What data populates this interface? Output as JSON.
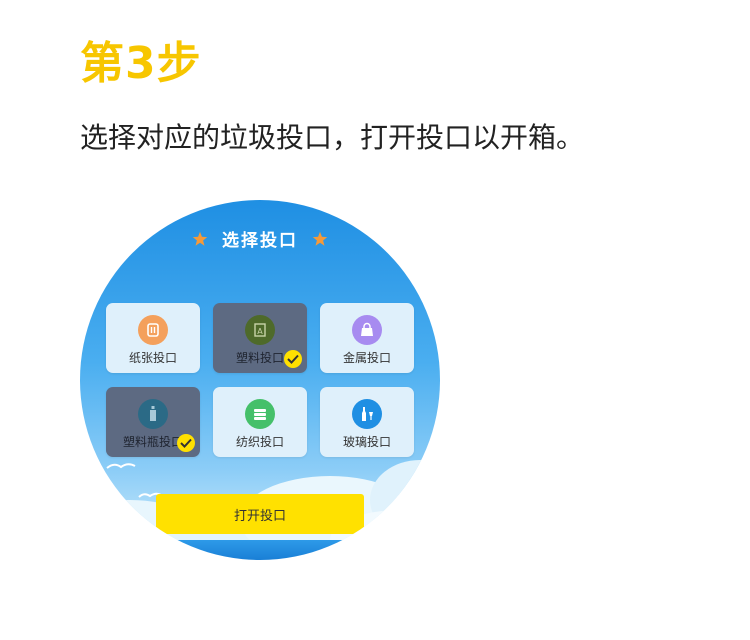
{
  "step": {
    "title": "第3步"
  },
  "instruction": {
    "text": "选择对应的垃圾投口，打开投口以开箱。"
  },
  "screen": {
    "header_title": "选择投口",
    "tiles": [
      {
        "label": "纸张投口",
        "icon": "paper-icon",
        "color": "#f4a05c",
        "selected": false
      },
      {
        "label": "塑料投口",
        "icon": "plastic-icon",
        "color": "#4e6a2a",
        "selected": true
      },
      {
        "label": "金属投口",
        "icon": "metal-icon",
        "color": "#a78bf0",
        "selected": false
      },
      {
        "label": "塑料瓶投口",
        "icon": "plastic-bottle-icon",
        "color": "#2b6a86",
        "selected": true
      },
      {
        "label": "纺织投口",
        "icon": "textile-icon",
        "color": "#45c06a",
        "selected": false
      },
      {
        "label": "玻璃投口",
        "icon": "glass-icon",
        "color": "#1f8fe3",
        "selected": false
      }
    ],
    "open_button_label": "打开投口"
  },
  "colors": {
    "accent_yellow": "#f7c600",
    "button_yellow": "#ffe100",
    "sky_blue": "#1f8fe3"
  }
}
